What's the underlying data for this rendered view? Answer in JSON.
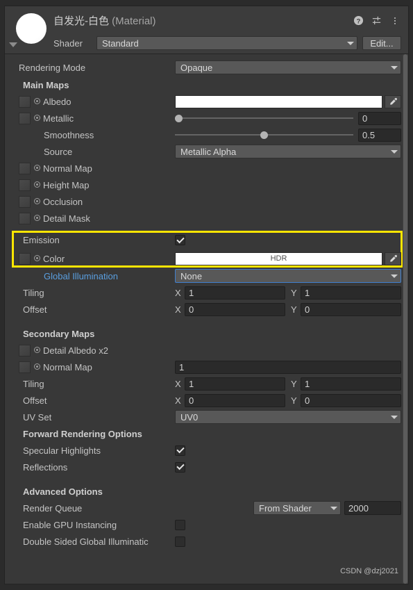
{
  "header": {
    "title_main": "自发光-白色",
    "title_suffix": " (Material)",
    "shader_label": "Shader",
    "shader_value": "Standard",
    "edit_button": "Edit...",
    "help_icon": "help-icon",
    "preset_icon": "preset-sliders-icon",
    "menu_icon": "kebab-menu-icon",
    "preview_swatch_color": "#ffffff"
  },
  "rendering_mode": {
    "label": "Rendering Mode",
    "value": "Opaque"
  },
  "main_maps": {
    "section_label": "Main Maps",
    "albedo": {
      "label": "Albedo",
      "color": "#ffffff"
    },
    "metallic": {
      "label": "Metallic",
      "value": "0",
      "slider_fraction": 0
    },
    "smoothness": {
      "label": "Smoothness",
      "value": "0.5",
      "slider_fraction": 0.5
    },
    "source": {
      "label": "Source",
      "value": "Metallic Alpha"
    },
    "normal_map": {
      "label": "Normal Map"
    },
    "height_map": {
      "label": "Height Map"
    },
    "occlusion": {
      "label": "Occlusion"
    },
    "detail_mask": {
      "label": "Detail Mask"
    }
  },
  "emission": {
    "label": "Emission",
    "enabled": true,
    "color_label": "Color",
    "color_hdr_text": "HDR",
    "color_value": "#ffffff",
    "global_illumination_label": "Global Illumination",
    "global_illumination_value": "None",
    "tiling_label": "Tiling",
    "tiling_x": "1",
    "tiling_y": "1",
    "offset_label": "Offset",
    "offset_x": "0",
    "offset_y": "0",
    "axis_x": "X",
    "axis_y": "Y",
    "highlight_color": "#ffe600"
  },
  "secondary_maps": {
    "section_label": "Secondary Maps",
    "detail_albedo": {
      "label": "Detail Albedo x2"
    },
    "normal_map": {
      "label": "Normal Map",
      "value": "1"
    },
    "tiling_label": "Tiling",
    "tiling_x": "1",
    "tiling_y": "1",
    "offset_label": "Offset",
    "offset_x": "0",
    "offset_y": "0",
    "axis_x": "X",
    "axis_y": "Y",
    "uv_set": {
      "label": "UV Set",
      "value": "UV0"
    }
  },
  "forward_rendering": {
    "section_label": "Forward Rendering Options",
    "specular_highlights": {
      "label": "Specular Highlights",
      "enabled": true
    },
    "reflections": {
      "label": "Reflections",
      "enabled": true
    }
  },
  "advanced": {
    "section_label": "Advanced Options",
    "render_queue": {
      "label": "Render Queue",
      "mode": "From Shader",
      "value": "2000"
    },
    "gpu_instancing": {
      "label": "Enable GPU Instancing",
      "enabled": false
    },
    "double_sided_gi": {
      "label": "Double Sided Global Illuminatic",
      "enabled": false
    }
  },
  "watermark": "CSDN @dzj2021"
}
